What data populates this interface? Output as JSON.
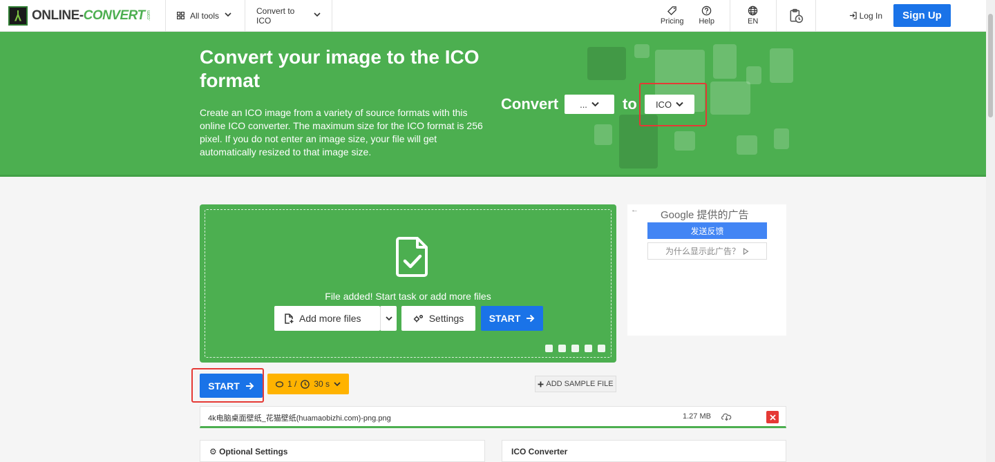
{
  "header": {
    "logo_text_1": "ONLINE-",
    "logo_text_2": "CONVERT",
    "logo_com": ".com",
    "nav": [
      {
        "label": "All tools"
      },
      {
        "label": "Convert to ICO"
      }
    ],
    "pricing": "Pricing",
    "help": "Help",
    "language": "EN",
    "login": "Log In",
    "signup": "Sign Up"
  },
  "hero": {
    "title": "Convert your image to the ICO format",
    "description": "Create an ICO image from a variety of source formats with this online ICO converter. The maximum size for the ICO format is 256 pixel. If you do not enter an image size, your file will get automatically resized to that image size.",
    "convert_label": "Convert",
    "from_value": "...",
    "to_label": "to",
    "to_value": "ICO"
  },
  "dropzone": {
    "message": "File added! Start task or add more files",
    "add_more": "Add more files",
    "settings": "Settings",
    "start": "START"
  },
  "ad": {
    "header": "Google 提供的广告",
    "feedback": "发送反馈",
    "why": "为什么显示此广告？"
  },
  "actions": {
    "start": "START",
    "credits": "1 /",
    "time": "30 s",
    "sample": "ADD SAMPLE FILE"
  },
  "file": {
    "name": "4k电脑桌面壁纸_花猫壁纸(huamaobizhi.com)-png.png",
    "size": "1.27 MB"
  },
  "panels": {
    "optional": "Optional Settings",
    "converter": "ICO Converter"
  },
  "colors": {
    "green": "#4caf50",
    "blue": "#1a73e8",
    "amber": "#ffb300",
    "red": "#e53935"
  }
}
